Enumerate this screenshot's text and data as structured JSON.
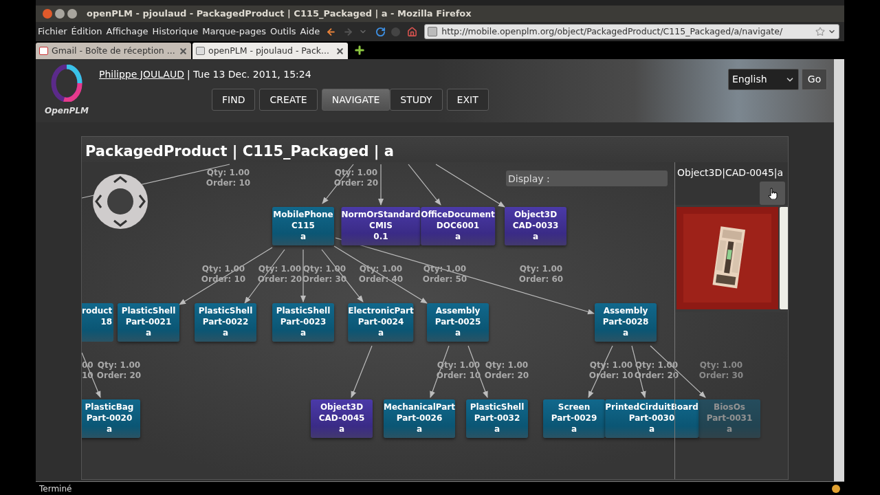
{
  "window": {
    "title": "openPLM - pjoulaud - PackagedProduct | C115_Packaged | a - Mozilla Firefox"
  },
  "menu": [
    "Fichier",
    "Édition",
    "Affichage",
    "Historique",
    "Marque-pages",
    "Outils",
    "Aide"
  ],
  "address": "http://mobile.openplm.org/object/PackagedProduct/C115_Packaged/a/navigate/",
  "tabs": [
    {
      "label": "Gmail - Boîte de réception ...",
      "selected": false
    },
    {
      "label": "openPLM - pjoulaud - Pack...",
      "selected": true
    }
  ],
  "header": {
    "brand": "OpenPLM",
    "user": "Philippe JOULAUD",
    "date": "| Tue 13 Dec. 2011, 15:24",
    "language": "English",
    "go": "Go"
  },
  "nav": [
    {
      "label": "FIND",
      "selected": false
    },
    {
      "label": "CREATE",
      "selected": false
    },
    {
      "label": "NAVIGATE",
      "selected": true
    },
    {
      "label": "STUDY",
      "selected": false
    },
    {
      "label": "EXIT",
      "selected": false
    }
  ],
  "graph": {
    "title": "PackagedProduct | C115_Packaged | a",
    "display_placeholder": "Display :",
    "nodes": [
      {
        "kind": "part",
        "lines": [
          "MobilePhone",
          "C115",
          "a"
        ]
      },
      {
        "kind": "document",
        "lines": [
          "NormOrStandard",
          "CMIS",
          "0.1"
        ]
      },
      {
        "kind": "document",
        "lines": [
          "OfficeDocument",
          "DOC6001",
          "a"
        ]
      },
      {
        "kind": "document",
        "lines": [
          "Object3D",
          "CAD-0033",
          "a"
        ]
      },
      {
        "kind": "part",
        "lines": [
          "roduct",
          "18"
        ],
        "cut_left": true
      },
      {
        "kind": "part",
        "lines": [
          "PlasticShell",
          "Part-0021",
          "a"
        ]
      },
      {
        "kind": "part",
        "lines": [
          "PlasticShell",
          "Part-0022",
          "a"
        ]
      },
      {
        "kind": "part",
        "lines": [
          "PlasticShell",
          "Part-0023",
          "a"
        ]
      },
      {
        "kind": "part",
        "lines": [
          "ElectronicPart",
          "Part-0024",
          "a"
        ]
      },
      {
        "kind": "part",
        "lines": [
          "Assembly",
          "Part-0025",
          "a"
        ]
      },
      {
        "kind": "part",
        "lines": [
          "Assembly",
          "Part-0028",
          "a"
        ]
      },
      {
        "kind": "part",
        "lines": [
          "PlasticBag",
          "Part-0020",
          "a"
        ]
      },
      {
        "kind": "document",
        "lines": [
          "Object3D",
          "CAD-0045",
          "a"
        ]
      },
      {
        "kind": "part",
        "lines": [
          "MechanicalPart",
          "Part-0026",
          "a"
        ]
      },
      {
        "kind": "part",
        "lines": [
          "PlasticShell",
          "Part-0032",
          "a"
        ]
      },
      {
        "kind": "part",
        "lines": [
          "Screen",
          "Part-0029",
          "a"
        ]
      },
      {
        "kind": "part",
        "lines": [
          "PrintedCirduitBoard",
          "Part-0030",
          "a"
        ]
      },
      {
        "kind": "part",
        "lines": [
          "BiosOs",
          "Part-0031",
          "a"
        ]
      }
    ],
    "links": [
      {
        "qty": "Qty: 1.00",
        "order": "Order: 10"
      },
      {
        "qty": "Qty: 1.00",
        "order": "Order: 20"
      },
      {
        "qty": "Qty: 1.00",
        "order": "Order: 10"
      },
      {
        "qty": "Qty: 1.00",
        "order": "Order: 20"
      },
      {
        "qty": "Qty: 1.00",
        "order": "Order: 30"
      },
      {
        "qty": "Qty: 1.00",
        "order": "Order: 40"
      },
      {
        "qty": "Qty: 1.00",
        "order": "Order: 50"
      },
      {
        "qty": "Qty: 1.00",
        "order": "Order: 60"
      },
      {
        "qty": "00",
        "order": "10",
        "cut_left": true
      },
      {
        "qty": "Qty: 1.00",
        "order": "Order: 20"
      },
      {
        "qty": "Qty: 1.00",
        "order": "Order: 10"
      },
      {
        "qty": "Qty: 1.00",
        "order": "Order: 20"
      },
      {
        "qty": "Qty: 1.00",
        "order": "Order: 10"
      },
      {
        "qty": "Qty: 1.00",
        "order": "Order: 20"
      },
      {
        "qty": "Qty: 1.00",
        "order": "Order: 30"
      }
    ]
  },
  "side_panel": {
    "title": "Object3D|CAD-0045|a"
  },
  "status": "Terminé"
}
